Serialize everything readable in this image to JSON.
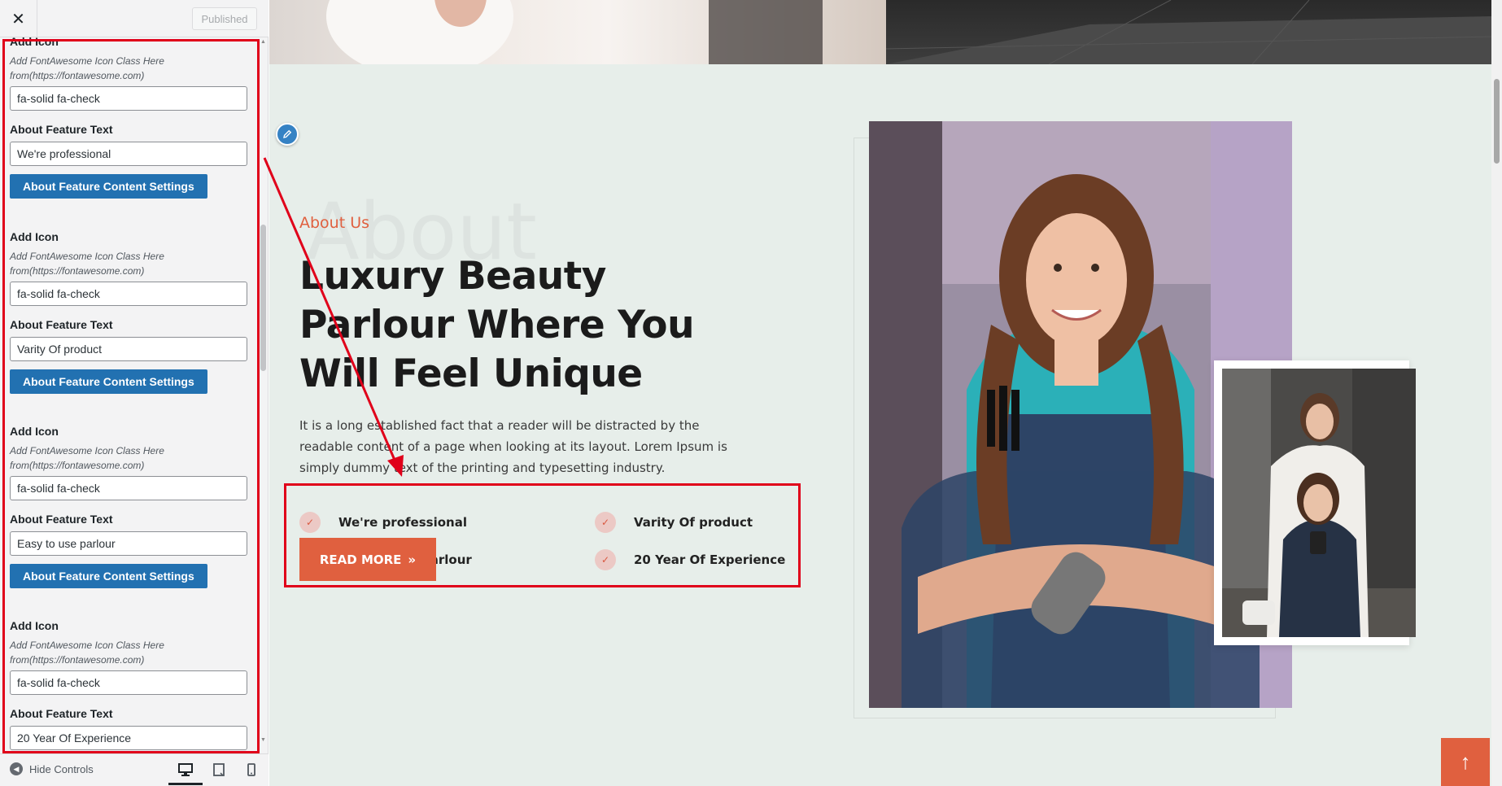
{
  "sidebar": {
    "close_glyph": "✕",
    "publish_label": "Published",
    "controls": [
      {
        "icon_title": "Add Icon",
        "icon_desc": "Add FontAwesome Icon Class Here from(https://fontawesome.com)",
        "icon_value": "fa-solid fa-check",
        "text_title": "About Feature Text",
        "text_value": "We're professional",
        "button_label": "About Feature Content Settings"
      },
      {
        "icon_title": "Add Icon",
        "icon_desc": "Add FontAwesome Icon Class Here from(https://fontawesome.com)",
        "icon_value": "fa-solid fa-check",
        "text_title": "About Feature Text",
        "text_value": "Varity Of product",
        "button_label": "About Feature Content Settings"
      },
      {
        "icon_title": "Add Icon",
        "icon_desc": "Add FontAwesome Icon Class Here from(https://fontawesome.com)",
        "icon_value": "fa-solid fa-check",
        "text_title": "About Feature Text",
        "text_value": "Easy to use parlour",
        "button_label": "About Feature Content Settings"
      },
      {
        "icon_title": "Add Icon",
        "icon_desc": "Add FontAwesome Icon Class Here from(https://fontawesome.com)",
        "icon_value": "fa-solid fa-check",
        "text_title": "About Feature Text",
        "text_value": "20 Year Of Experience"
      }
    ],
    "footer": {
      "hide_controls_label": "Hide Controls",
      "devices": [
        "desktop-icon",
        "tablet-icon",
        "mobile-icon"
      ]
    }
  },
  "preview": {
    "watermark": "About",
    "about_tag": "About Us",
    "heading": "Luxury Beauty Parlour Where You Will Feel Unique",
    "description": "It is a long established fact that a reader will be distracted by the readable content of a page when looking at its layout. Lorem Ipsum is simply dummy text of the printing and typesetting industry.",
    "features": [
      {
        "icon": "check-icon",
        "label": "We're professional"
      },
      {
        "icon": "check-icon",
        "label": "Varity Of product"
      },
      {
        "icon": "check-icon",
        "label": "Easy to use parlour"
      },
      {
        "icon": "check-icon",
        "label": "20 Year Of Experience"
      }
    ],
    "read_more_label": "READ MORE",
    "back_to_top_glyph": "↑"
  },
  "colors": {
    "accent": "#e0603f",
    "wp_blue": "#2271b1",
    "annotation_red": "#e0001a",
    "section_bg": "#e7eeea"
  }
}
